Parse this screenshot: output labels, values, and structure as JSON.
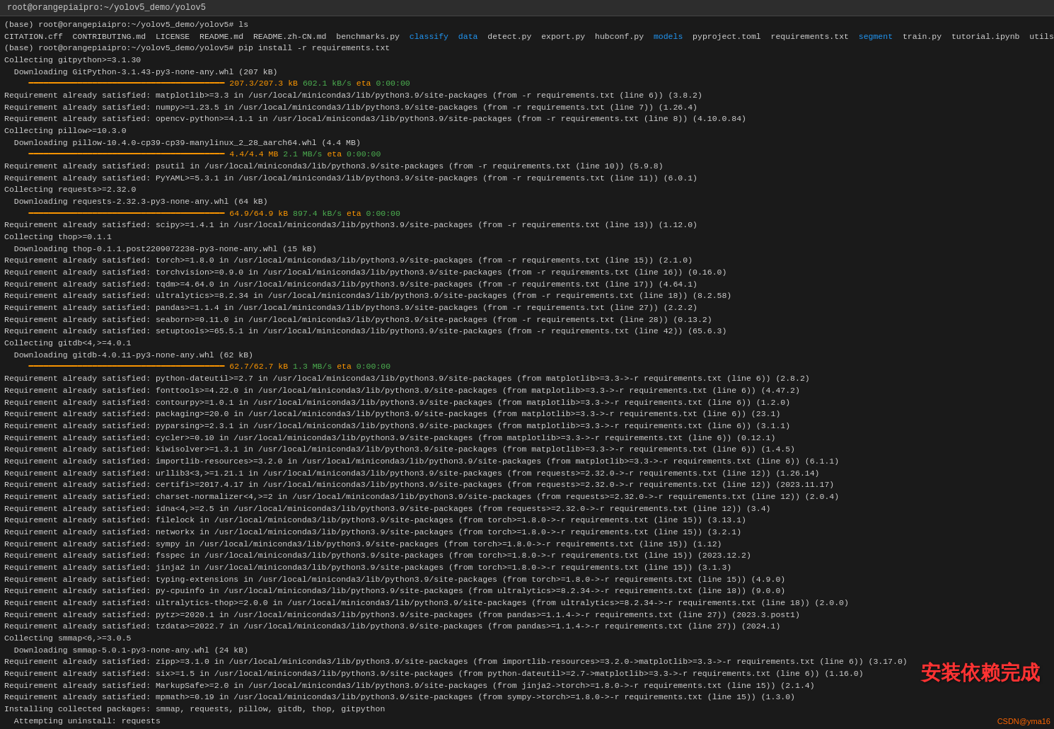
{
  "terminal": {
    "title": "root@orangepiaipro:~/yolov5_demo/yolov5",
    "titlebar": "root@orangepiaipro:~/yolov5_demo/yolov5",
    "lines": []
  },
  "watermark": "安装依赖完成",
  "csdn_label": "CSDN@yma16"
}
